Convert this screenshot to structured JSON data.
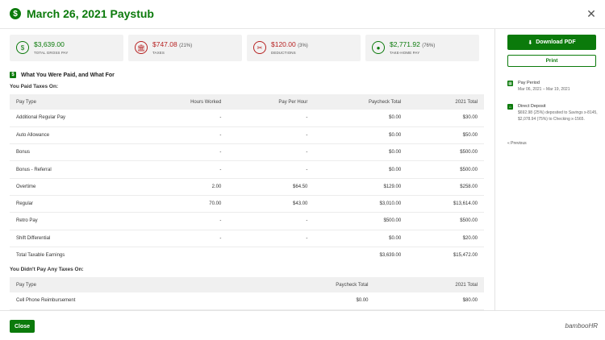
{
  "header": {
    "title": "March 26, 2021 Paystub"
  },
  "summary_cards": [
    {
      "value": "$3,639.00",
      "percent": "",
      "label": "TOTAL GROSS PAY",
      "color": "#0b7a0b",
      "icon": "money-icon"
    },
    {
      "value": "$747.08",
      "percent": "(21%)",
      "label": "TAXES",
      "color": "#b72121",
      "icon": "government-building-icon"
    },
    {
      "value": "$120.00",
      "percent": "(3%)",
      "label": "DEDUCTIONS",
      "color": "#b72121",
      "icon": "deductions-icon"
    },
    {
      "value": "$2,771.92",
      "percent": "(76%)",
      "label": "TAKE-HOME PAY",
      "color": "#0b7a0b",
      "icon": "piggy-bank-icon"
    }
  ],
  "section": {
    "title": "What You Were Paid, and What For",
    "taxed_heading": "You Paid Taxes On:",
    "untaxed_heading": "You Didn't Pay Any Taxes On:"
  },
  "taxed_table": {
    "headers": [
      "Pay Type",
      "Hours Worked",
      "Pay Per Hour",
      "Paycheck Total",
      "2021 Total"
    ],
    "rows": [
      [
        "Additional Regular Pay",
        "-",
        "-",
        "$0.00",
        "$30.00"
      ],
      [
        "Auto Allowance",
        "-",
        "-",
        "$0.00",
        "$50.00"
      ],
      [
        "Bonus",
        "-",
        "-",
        "$0.00",
        "$500.00"
      ],
      [
        "Bonus - Referral",
        "-",
        "-",
        "$0.00",
        "$500.00"
      ],
      [
        "Overtime",
        "2.00",
        "$64.50",
        "$129.00",
        "$258.00"
      ],
      [
        "Regular",
        "70.00",
        "$43.00",
        "$3,010.00",
        "$13,614.00"
      ],
      [
        "Retro Pay",
        "-",
        "-",
        "$500.00",
        "$500.00"
      ],
      [
        "Shift Differential",
        "-",
        "-",
        "$0.00",
        "$20.00"
      ]
    ],
    "total": [
      "Total Taxable Earnings",
      "",
      "",
      "$3,639.00",
      "$15,472.00"
    ]
  },
  "untaxed_table": {
    "headers": [
      "Pay Type",
      "Paycheck Total",
      "2021 Total"
    ],
    "rows": [
      [
        "Cell Phone Reimbursement",
        "$0.00",
        "$80.00"
      ]
    ]
  },
  "sidebar": {
    "download_label": "Download PDF",
    "print_label": "Print",
    "pay_period_title": "Pay Period",
    "pay_period_value": "Mar 06, 2021 – Mar 19, 2021",
    "direct_deposit_title": "Direct Deposit",
    "direct_deposit_value": "$692.98 (25%) deposited to Savings x-8145, $2,078.94 (75%) to Checking x-1565.",
    "previous_label": "« Previous"
  },
  "footer": {
    "close_label": "Close",
    "brand": "bambooHR"
  }
}
